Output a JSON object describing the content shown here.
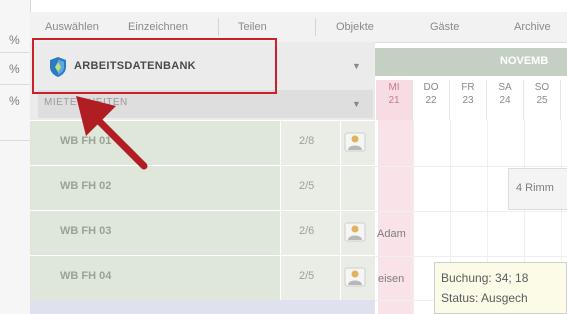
{
  "left_strip": {
    "values": [
      "%",
      "%",
      "%"
    ]
  },
  "menu": {
    "items": [
      "Auswählen",
      "Einzeichnen",
      "Teilen",
      "Objekte",
      "Gäste",
      "Archive"
    ]
  },
  "dropdown": {
    "primary_label": "ARBEITSDATENBANK",
    "secondary_label": "MIETEINHEITEN",
    "arrow": "▼"
  },
  "rows": [
    {
      "name": "WB FH 01",
      "count": "2/8"
    },
    {
      "name": "WB FH 02",
      "count": "2/5"
    },
    {
      "name": "WB FH 03",
      "count": "2/6"
    },
    {
      "name": "WB FH 04",
      "count": "2/5"
    }
  ],
  "calendar": {
    "month": "NOVEMB",
    "days": [
      {
        "name": "MI",
        "num": "21"
      },
      {
        "name": "DO",
        "num": "22"
      },
      {
        "name": "FR",
        "num": "23"
      },
      {
        "name": "SA",
        "num": "24"
      },
      {
        "name": "SO",
        "num": "25"
      }
    ],
    "bookings": {
      "row2_text": "4 Rimm",
      "row3_text": "Adam",
      "row4_text": "eisen"
    }
  },
  "tooltip": {
    "line1": "Buchung: 34; 18",
    "line2": "Status: Ausgech"
  },
  "colors": {
    "highlight": "#c9202b",
    "pointer": "#b01e24",
    "shield": "#2a7bc4"
  }
}
